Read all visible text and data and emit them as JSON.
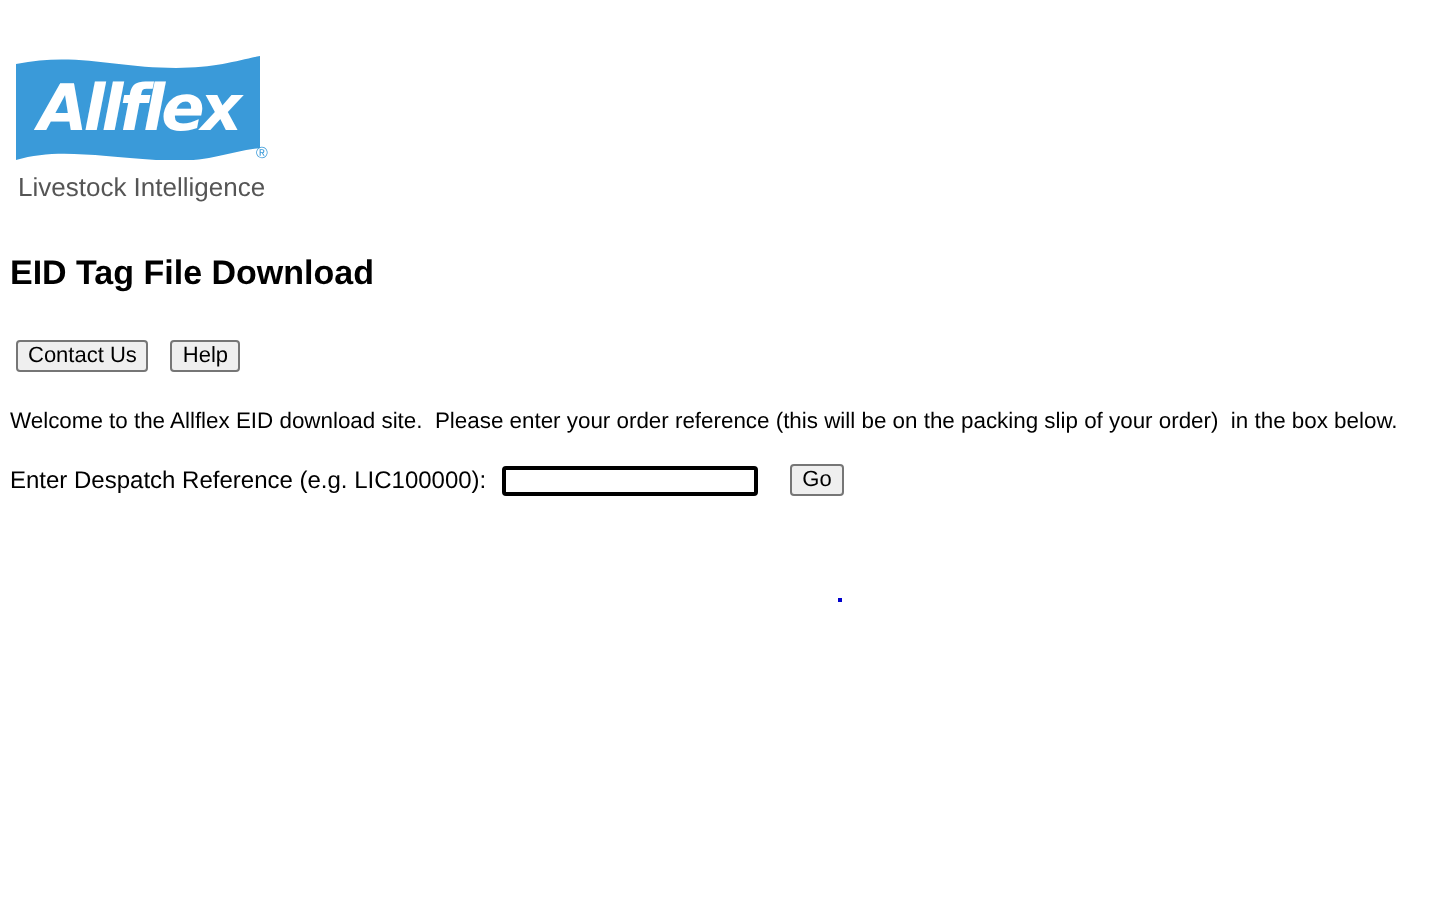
{
  "logo": {
    "name": "Allflex",
    "mark": "®",
    "tagline": "Livestock Intelligence"
  },
  "heading": "EID Tag File Download",
  "buttons": [
    {
      "label": "Contact Us"
    },
    {
      "label": "Help"
    }
  ],
  "intro": "Welcome to the Allflex EID download site.  Please enter your order reference (this will be on the packing slip of your order)  in the box below.",
  "form": {
    "label": "Enter Despatch Reference (e.g. LIC100000):",
    "button": "Go"
  }
}
